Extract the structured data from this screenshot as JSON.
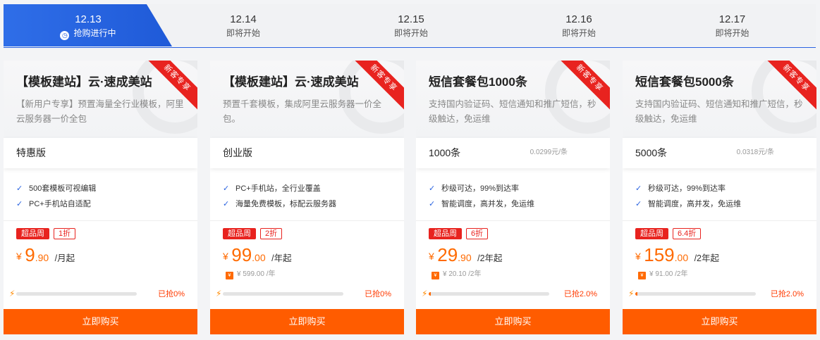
{
  "tabs": [
    {
      "date": "12.13",
      "status": "抢购进行中"
    },
    {
      "date": "12.14",
      "status": "即将开始"
    },
    {
      "date": "12.15",
      "status": "即将开始"
    },
    {
      "date": "12.16",
      "status": "即将开始"
    },
    {
      "date": "12.17",
      "status": "即将开始"
    }
  ],
  "colors": {
    "accent": "#2a63e0",
    "price": "#ff6a00",
    "buy_button": "#ff5c00",
    "badge": "#e8231f"
  },
  "cards": [
    {
      "ribbon": "新客专享",
      "title": "【模板建站】云·速成美站",
      "desc": "【新用户专享】预置海量全行业模板，阿里云服务器一价全包",
      "spec_name": "特惠版",
      "spec_unit": "",
      "features": [
        "500套模板可视编辑",
        "PC+手机站自适配"
      ],
      "badge_week": "超品周",
      "badge_discount": "1折",
      "currency": "¥",
      "price_int": "9",
      "price_dec": ".90",
      "price_period": "/月起",
      "orig_price": "",
      "progress": 0,
      "sold_text": "已抢0%",
      "buy_label": "立即购买"
    },
    {
      "ribbon": "新客专享",
      "title": "【模板建站】云·速成美站",
      "desc": "预置千套模板，集成阿里云服务器一价全包。",
      "spec_name": "创业版",
      "spec_unit": "",
      "features": [
        "PC+手机站，全行业覆盖",
        "海量免费模板，标配云服务器"
      ],
      "badge_week": "超品周",
      "badge_discount": "2折",
      "currency": "¥",
      "price_int": "99",
      "price_dec": ".00",
      "price_period": "/年起",
      "orig_price": "¥ 599.00 /年",
      "progress": 0,
      "sold_text": "已抢0%",
      "buy_label": "立即购买"
    },
    {
      "ribbon": "新客专享",
      "title": "短信套餐包1000条",
      "desc": "支持国内验证码、短信通知和推广短信，秒级触达，免运维",
      "spec_name": "1000条",
      "spec_unit": "0.0299元/条",
      "features": [
        "秒级可达，99%到达率",
        "智能调度，高并发，免运维"
      ],
      "badge_week": "超品周",
      "badge_discount": "6折",
      "currency": "¥",
      "price_int": "29",
      "price_dec": ".90",
      "price_period": "/2年起",
      "orig_price": "¥ 20.10 /2年",
      "progress": 2,
      "sold_text": "已抢2.0%",
      "buy_label": "立即购买"
    },
    {
      "ribbon": "新客专享",
      "title": "短信套餐包5000条",
      "desc": "支持国内验证码、短信通知和推广短信，秒级触达，免运维",
      "spec_name": "5000条",
      "spec_unit": "0.0318元/条",
      "features": [
        "秒级可达，99%到达率",
        "智能调度，高并发，免运维"
      ],
      "badge_week": "超品周",
      "badge_discount": "6.4折",
      "currency": "¥",
      "price_int": "159",
      "price_dec": ".00",
      "price_period": "/2年起",
      "orig_price": "¥ 91.00 /2年",
      "progress": 2,
      "sold_text": "已抢2.0%",
      "buy_label": "立即购买"
    }
  ]
}
